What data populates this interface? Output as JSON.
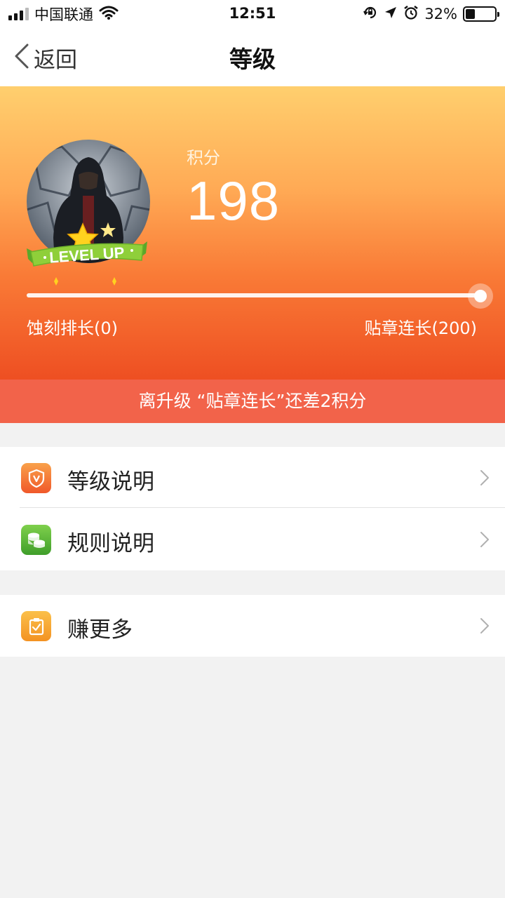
{
  "status_bar": {
    "carrier": "中国联通",
    "time": "12:51",
    "battery_percent": "32%",
    "battery_level": 0.32,
    "icons": [
      "wifi-icon",
      "rotation-lock-icon",
      "location-arrow-icon",
      "alarm-icon",
      "battery-icon"
    ]
  },
  "nav": {
    "back_label": "返回",
    "title": "等级"
  },
  "hero": {
    "score_label": "积分",
    "score_value": "198",
    "badge_text": "LEVEL UP",
    "progress": {
      "current": 198,
      "max": 200,
      "fraction": 0.99
    },
    "current_level": "蚀刻排长(0)",
    "next_level": "贴章连长(200)",
    "colors": {
      "gradient_top": "#ffcf6e",
      "gradient_bottom": "#ee4f22",
      "badge_green": "#8fcf3a"
    }
  },
  "hint": "离升级 “贴章连长”还差2积分",
  "menu": {
    "group1": [
      {
        "label": "等级说明",
        "icon": "shield-v-icon",
        "color": "#f26a2e"
      },
      {
        "label": "规则说明",
        "icon": "coins-icon",
        "color": "#5cb83a"
      }
    ],
    "group2": [
      {
        "label": "赚更多",
        "icon": "clipboard-check-icon",
        "color": "#f7a531"
      }
    ]
  }
}
